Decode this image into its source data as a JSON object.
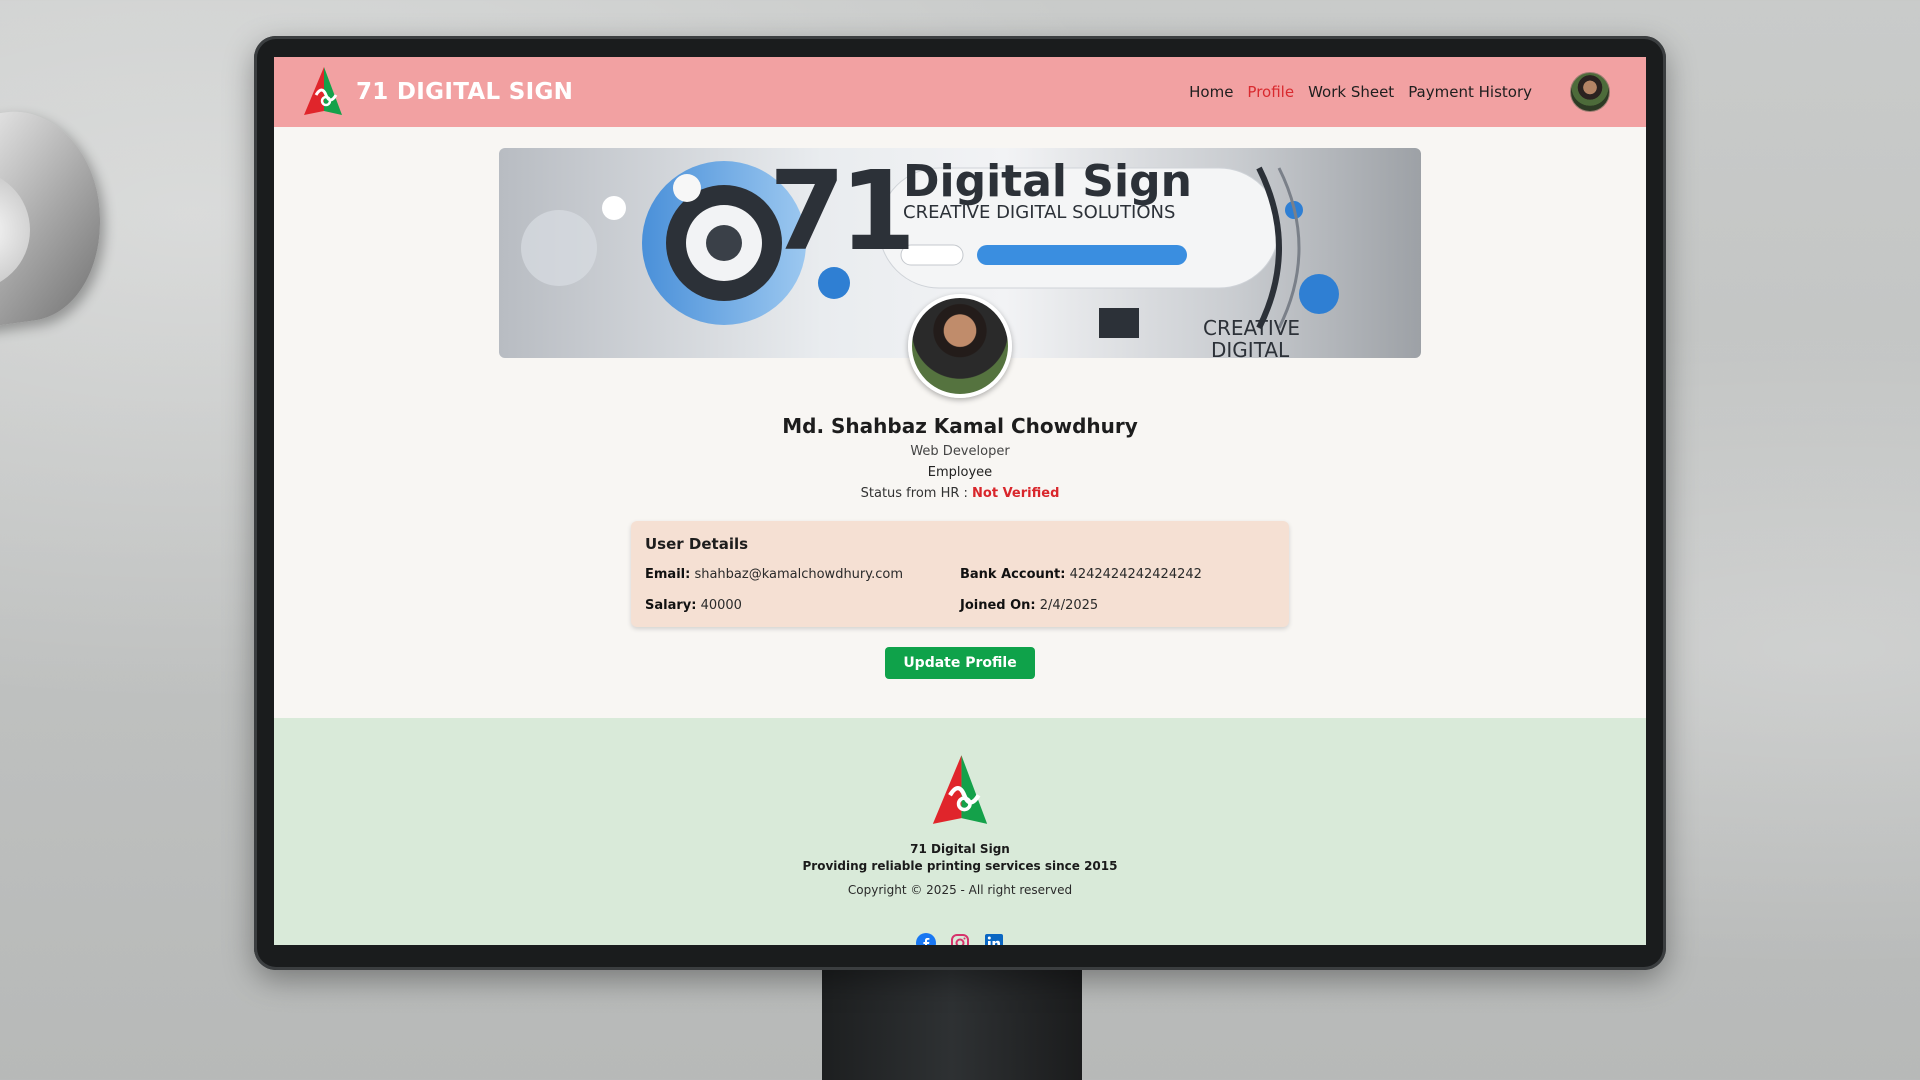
{
  "brand": {
    "name": "71 DIGITAL SIGN"
  },
  "nav": {
    "items": [
      {
        "label": "Home",
        "active": false
      },
      {
        "label": "Profile",
        "active": true
      },
      {
        "label": "Work Sheet",
        "active": false
      },
      {
        "label": "Payment History",
        "active": false
      }
    ]
  },
  "banner": {
    "number": "71",
    "title": "Digital Sign",
    "subtitle": "CREATIVE DIGITAL SOLUTIONS",
    "corner_text_1": "CREATIVE",
    "corner_text_2": "DIGITAL"
  },
  "profile": {
    "name": "Md. Shahbaz Kamal Chowdhury",
    "role": "Web Developer",
    "type": "Employee",
    "status_label": "Status from HR :",
    "status_value": "Not Verified"
  },
  "details": {
    "title": "User Details",
    "email_label": "Email:",
    "email": "shahbaz@kamalchowdhury.com",
    "bank_label": "Bank Account:",
    "bank": "4242424242424242",
    "salary_label": "Salary:",
    "salary": "40000",
    "joined_label": "Joined On:",
    "joined": "2/4/2025"
  },
  "actions": {
    "update_label": "Update Profile"
  },
  "footer": {
    "company": "71 Digital Sign",
    "tagline": "Providing reliable printing services since 2015",
    "copyright": "Copyright © 2025 - All right reserved"
  },
  "colors": {
    "nav_bg": "#f2a1a2",
    "active_link": "#d92a2f",
    "status_red": "#d9262b",
    "button_green": "#0fa24a",
    "footer_bg": "#d9ead9",
    "card_bg": "#f5e0d3"
  },
  "icons": [
    "logo-mark-icon",
    "facebook-icon",
    "instagram-icon",
    "linkedin-icon"
  ]
}
